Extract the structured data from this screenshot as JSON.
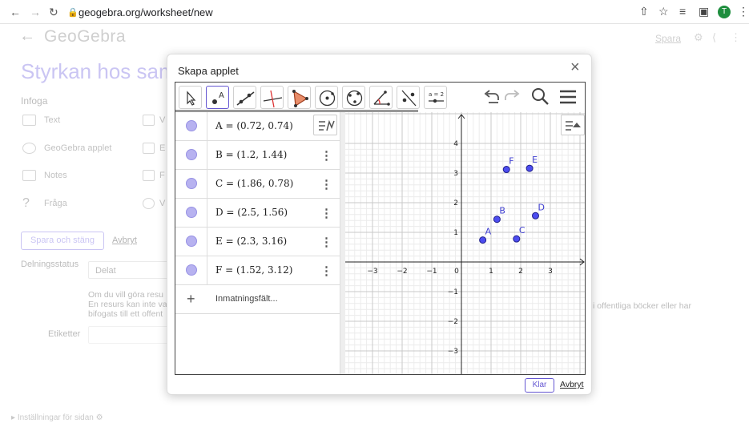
{
  "browser": {
    "url": "geogebra.org/worksheet/new",
    "avatar_letter": "T"
  },
  "page": {
    "logo": "GeoGebra",
    "save_link": "Spara",
    "title": "Styrkan hos samb",
    "insert_label": "Infoga",
    "insert_items": [
      "Text",
      "GeoGebra applet",
      "Notes",
      "Fråga"
    ],
    "insert_items_right": [
      "V",
      "E",
      "F",
      "V"
    ],
    "save_close_button": "Spara och stäng",
    "cancel_link": "Avbryt",
    "sharing_label": "Delningsstatus",
    "sharing_value": "Delat",
    "sharing_text_1": "Om du vill göra resu",
    "sharing_text_2": "En resurs kan inte va",
    "sharing_text_3": "bifogats till ett offent",
    "sharing_text_right": "i offentliga böcker eller har",
    "tags_label": "Etiketter",
    "settings_label": "Inställningar för sidan"
  },
  "modal": {
    "title": "Skapa applet",
    "done_button": "Klar",
    "cancel_link": "Avbryt"
  },
  "toolbar": {
    "tools": [
      "move-tool",
      "point-tool",
      "line-tool",
      "perpendicular-tool",
      "polygon-tool",
      "circle-center-tool",
      "circle-three-points-tool",
      "angle-tool",
      "reflect-tool",
      "slider-tool"
    ],
    "slider_label": "a = 2"
  },
  "algebra": {
    "rows": [
      {
        "expr": "A = (0.72, 0.74)"
      },
      {
        "expr": "B = (1.2, 1.44)"
      },
      {
        "expr": "C = (1.86, 0.78)"
      },
      {
        "expr": "D = (2.5, 1.56)"
      },
      {
        "expr": "E = (2.3, 3.16)"
      },
      {
        "expr": "F = (1.52, 3.12)"
      }
    ],
    "input_placeholder": "Inmatningsfält..."
  },
  "graphics": {
    "points": [
      {
        "name": "A",
        "x": 0.72,
        "y": 0.74
      },
      {
        "name": "B",
        "x": 1.2,
        "y": 1.44
      },
      {
        "name": "C",
        "x": 1.86,
        "y": 0.78
      },
      {
        "name": "D",
        "x": 2.5,
        "y": 1.56
      },
      {
        "name": "E",
        "x": 2.3,
        "y": 3.16
      },
      {
        "name": "F",
        "x": 1.52,
        "y": 3.12
      }
    ],
    "x_ticks": [
      -3,
      -2,
      -1,
      0,
      1,
      2,
      3
    ],
    "y_ticks": [
      -3,
      -2,
      -1,
      1,
      2,
      3,
      4
    ],
    "point_color": "#3f3fd0",
    "axis_color": "#222222"
  }
}
